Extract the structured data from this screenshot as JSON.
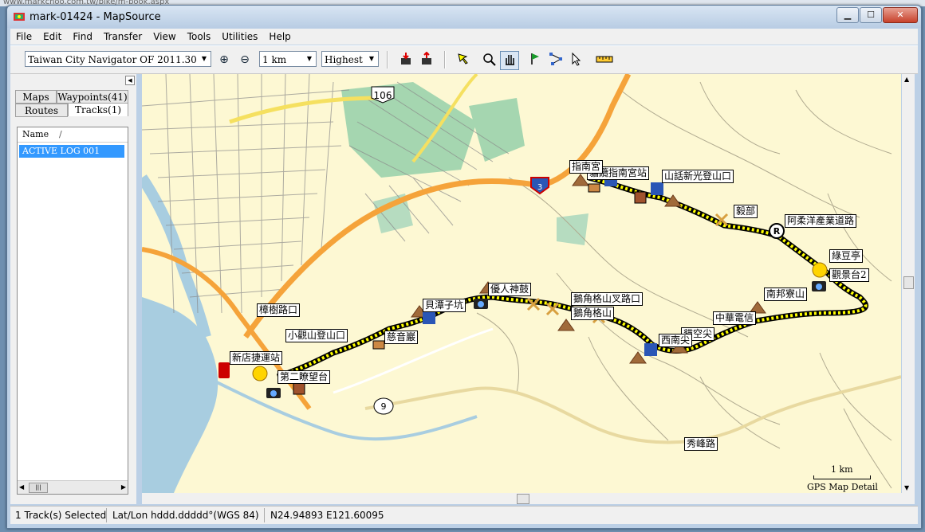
{
  "browser": {
    "url_fragment": "www.markchoo.com.tw/bike/m-book.aspx"
  },
  "window": {
    "title": "mark-01424 - MapSource",
    "min": "▁",
    "max": "☐",
    "close": "✕"
  },
  "menu": [
    "File",
    "Edit",
    "Find",
    "Transfer",
    "View",
    "Tools",
    "Utilities",
    "Help"
  ],
  "toolbar": {
    "map_product": "Taiwan City Navigator OF 2011.30",
    "zoom_in": "⊕",
    "zoom_out": "⊖",
    "scale": "1 km",
    "detail": "Highest"
  },
  "left_panel": {
    "tabs_top": [
      "Maps",
      "Waypoints(41)"
    ],
    "tabs_bottom": [
      "Routes",
      "Tracks(1)"
    ],
    "column_name": "Name",
    "column_sort": "/",
    "track": "ACTIVE LOG 001"
  },
  "map": {
    "labels": [
      "貓纜指南宮站",
      "指南宮",
      "山話新光登山口",
      "毅部",
      "阿柔洋產業道路",
      "綠豆亭",
      "觀景台2",
      "南邦寮山",
      "中華電信",
      "貓空尖",
      "西南尖",
      "鵝角格山叉路口",
      "鵝角格山",
      "優人神鼓",
      "貝潭子坑",
      "樟樹路口",
      "小觀山登山口",
      "慈音巖",
      "新店捷運站",
      "第二瞭望台",
      "秀峰路"
    ],
    "road_shields": [
      "106",
      "3",
      "9"
    ],
    "scale_text": "1 km",
    "detail_text": "GPS Map Detail",
    "colors": {
      "land": "#fdf8d3",
      "highway": "#f5a33a",
      "river": "#a8cde0",
      "park": "#a5d6b0",
      "track": "#ffff00"
    }
  },
  "status": {
    "selection": "1 Track(s) Selected",
    "format": "Lat/Lon hddd.ddddd°(WGS 84)",
    "position": "N24.94893 E121.60095"
  }
}
